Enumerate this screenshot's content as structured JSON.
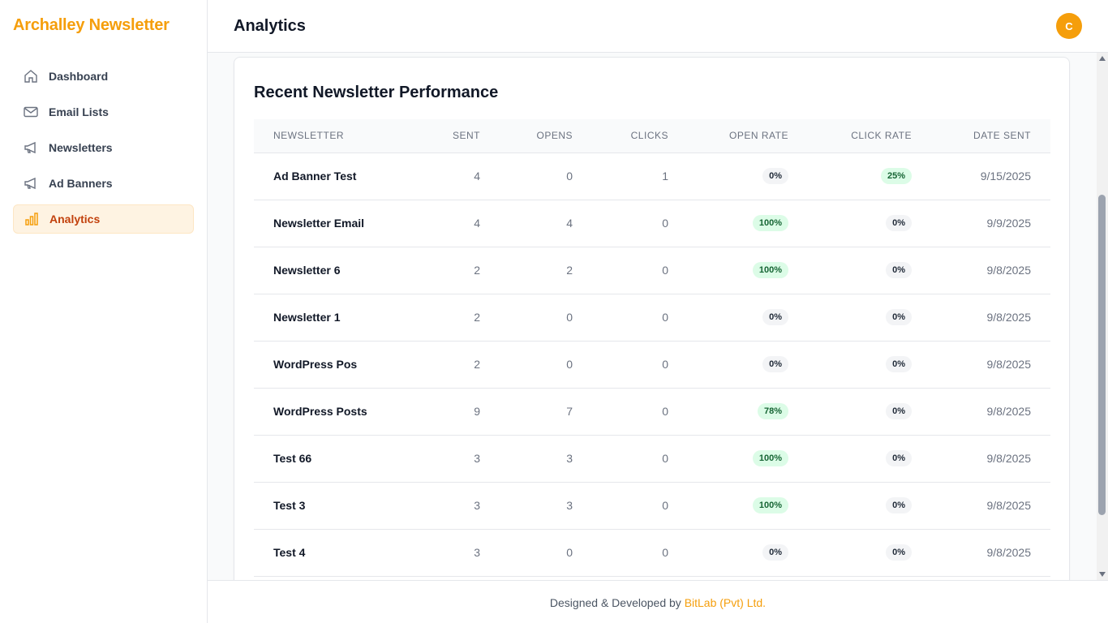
{
  "brand": {
    "name": "Archalley Newsletter",
    "color": "#f59e0b"
  },
  "sidebar": {
    "items": [
      {
        "label": "Dashboard",
        "icon": "home-icon",
        "active": false
      },
      {
        "label": "Email Lists",
        "icon": "mail-icon",
        "active": false
      },
      {
        "label": "Newsletters",
        "icon": "megaphone-icon",
        "active": false
      },
      {
        "label": "Ad Banners",
        "icon": "megaphone-icon",
        "active": false
      },
      {
        "label": "Analytics",
        "icon": "bar-chart-icon",
        "active": true
      }
    ]
  },
  "header": {
    "title": "Analytics",
    "avatar_initial": "C"
  },
  "card": {
    "title": "Recent Newsletter Performance",
    "columns": [
      "NEWSLETTER",
      "SENT",
      "OPENS",
      "CLICKS",
      "OPEN RATE",
      "CLICK RATE",
      "DATE SENT"
    ],
    "rows": [
      {
        "newsletter": "Ad Banner Test",
        "sent": "4",
        "opens": "0",
        "clicks": "1",
        "open_rate": "0%",
        "click_rate": "25%",
        "date_sent": "9/15/2025"
      },
      {
        "newsletter": "Newsletter Email",
        "sent": "4",
        "opens": "4",
        "clicks": "0",
        "open_rate": "100%",
        "click_rate": "0%",
        "date_sent": "9/9/2025"
      },
      {
        "newsletter": "Newsletter 6",
        "sent": "2",
        "opens": "2",
        "clicks": "0",
        "open_rate": "100%",
        "click_rate": "0%",
        "date_sent": "9/8/2025"
      },
      {
        "newsletter": "Newsletter 1",
        "sent": "2",
        "opens": "0",
        "clicks": "0",
        "open_rate": "0%",
        "click_rate": "0%",
        "date_sent": "9/8/2025"
      },
      {
        "newsletter": "WordPress Pos",
        "sent": "2",
        "opens": "0",
        "clicks": "0",
        "open_rate": "0%",
        "click_rate": "0%",
        "date_sent": "9/8/2025"
      },
      {
        "newsletter": "WordPress Posts",
        "sent": "9",
        "opens": "7",
        "clicks": "0",
        "open_rate": "78%",
        "click_rate": "0%",
        "date_sent": "9/8/2025"
      },
      {
        "newsletter": "Test 66",
        "sent": "3",
        "opens": "3",
        "clicks": "0",
        "open_rate": "100%",
        "click_rate": "0%",
        "date_sent": "9/8/2025"
      },
      {
        "newsletter": "Test 3",
        "sent": "3",
        "opens": "3",
        "clicks": "0",
        "open_rate": "100%",
        "click_rate": "0%",
        "date_sent": "9/8/2025"
      },
      {
        "newsletter": "Test 4",
        "sent": "3",
        "opens": "0",
        "clicks": "0",
        "open_rate": "0%",
        "click_rate": "0%",
        "date_sent": "9/8/2025"
      }
    ]
  },
  "footer": {
    "text": "Designed & Developed by",
    "link": "BitLab (Pvt) Ltd."
  },
  "colors": {
    "accent": "#f59e0b",
    "badge_green_bg": "#dcfce7",
    "badge_gray_bg": "#f3f4f6"
  }
}
